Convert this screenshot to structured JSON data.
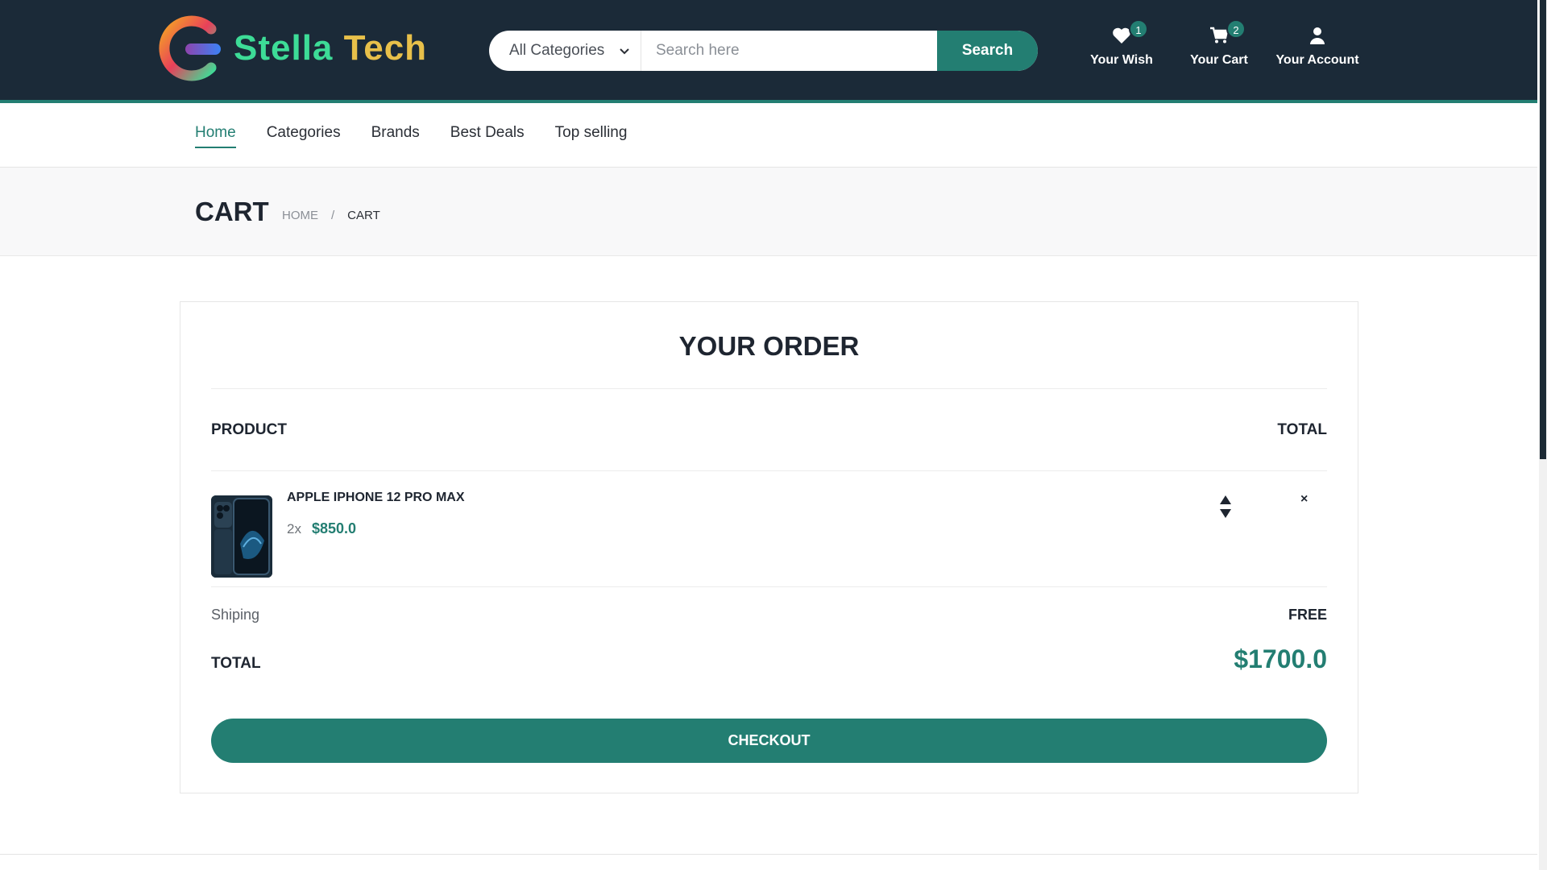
{
  "header": {
    "brand_part1": "Stella",
    "brand_part2": "Tech",
    "category_select": "All Categories",
    "search_placeholder": "Search here",
    "search_button": "Search",
    "wish": {
      "label": "Your Wish",
      "count": "1",
      "icon": "heart-icon"
    },
    "cart": {
      "label": "Your Cart",
      "count": "2",
      "icon": "cart-icon"
    },
    "account": {
      "label": "Your Account",
      "icon": "user-icon"
    }
  },
  "nav": {
    "items": [
      {
        "label": "Home",
        "active": true
      },
      {
        "label": "Categories",
        "active": false
      },
      {
        "label": "Brands",
        "active": false
      },
      {
        "label": "Best Deals",
        "active": false
      },
      {
        "label": "Top selling",
        "active": false
      }
    ]
  },
  "breadcrumb": {
    "title": "CART",
    "home": "HOME",
    "separator": "/",
    "current": "CART"
  },
  "order": {
    "title": "YOUR ORDER",
    "col_product": "PRODUCT",
    "col_total": "TOTAL",
    "item": {
      "name": "APPLE IPHONE 12 PRO MAX",
      "quantity": "2x",
      "price": "$850.0"
    },
    "remove_symbol": "×",
    "shipping_label": "Shiping",
    "shipping_value": "FREE",
    "total_label": "TOTAL",
    "total_value": "$1700.0",
    "checkout_label": "CHECKOUT"
  },
  "colors": {
    "header_bg": "#1b2a38",
    "accent": "#237e72",
    "logo_green": "#3ddc97",
    "logo_gold": "#e8c04a"
  }
}
